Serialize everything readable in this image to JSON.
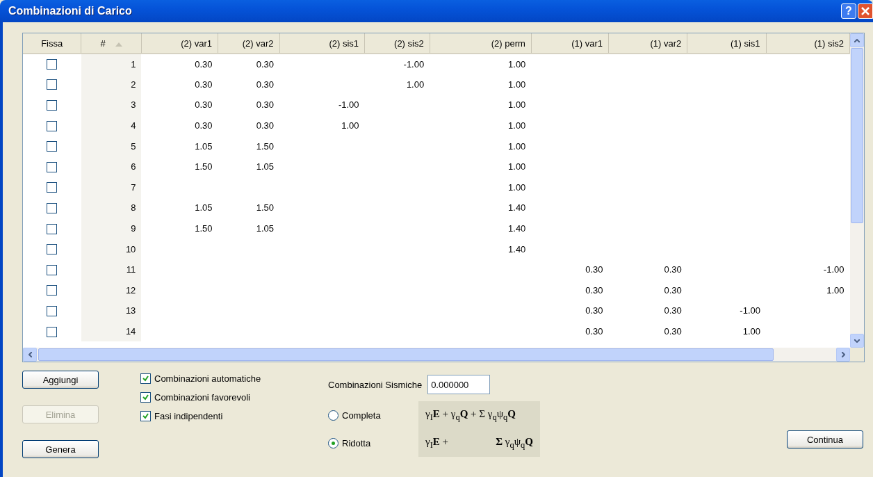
{
  "window": {
    "title": "Combinazioni di Carico",
    "buttons": [
      "?"
    ]
  },
  "table": {
    "columns": [
      {
        "label": "Fissa",
        "sorted": false
      },
      {
        "label": "#",
        "sorted": true
      },
      {
        "label": "(2) var1",
        "sorted": false
      },
      {
        "label": "(2) var2",
        "sorted": false
      },
      {
        "label": "(2) sis1",
        "sorted": false
      },
      {
        "label": "(2) sis2",
        "sorted": false
      },
      {
        "label": "(2) perm",
        "sorted": false
      },
      {
        "label": "(1) var1",
        "sorted": false
      },
      {
        "label": "(1) var2",
        "sorted": false
      },
      {
        "label": "(1) sis1",
        "sorted": false
      },
      {
        "label": "(1) sis2",
        "sorted": false
      }
    ],
    "rows": [
      {
        "cells": [
          {
            "kind": "check",
            "checked": false
          },
          {
            "kind": "number",
            "value": "1"
          },
          {
            "kind": "value",
            "value": "0.30"
          },
          {
            "kind": "value",
            "value": "0.30"
          },
          {
            "kind": "blank"
          },
          {
            "kind": "value",
            "value": "-1.00"
          },
          {
            "kind": "value",
            "value": "1.00"
          },
          {
            "kind": "blank"
          },
          {
            "kind": "blank"
          },
          {
            "kind": "blank"
          },
          {
            "kind": "blank"
          }
        ]
      },
      {
        "cells": [
          {
            "kind": "check",
            "checked": false
          },
          {
            "kind": "number",
            "value": "2"
          },
          {
            "kind": "value",
            "value": "0.30"
          },
          {
            "kind": "value",
            "value": "0.30"
          },
          {
            "kind": "blank"
          },
          {
            "kind": "value",
            "value": "1.00"
          },
          {
            "kind": "value",
            "value": "1.00"
          },
          {
            "kind": "blank"
          },
          {
            "kind": "blank"
          },
          {
            "kind": "blank"
          },
          {
            "kind": "blank"
          }
        ]
      },
      {
        "cells": [
          {
            "kind": "check",
            "checked": false
          },
          {
            "kind": "number",
            "value": "3"
          },
          {
            "kind": "value",
            "value": "0.30"
          },
          {
            "kind": "value",
            "value": "0.30"
          },
          {
            "kind": "value",
            "value": "-1.00"
          },
          {
            "kind": "blank"
          },
          {
            "kind": "value",
            "value": "1.00"
          },
          {
            "kind": "blank"
          },
          {
            "kind": "blank"
          },
          {
            "kind": "blank"
          },
          {
            "kind": "blank"
          }
        ]
      },
      {
        "cells": [
          {
            "kind": "check",
            "checked": false
          },
          {
            "kind": "number",
            "value": "4"
          },
          {
            "kind": "value",
            "value": "0.30"
          },
          {
            "kind": "value",
            "value": "0.30"
          },
          {
            "kind": "value",
            "value": "1.00"
          },
          {
            "kind": "blank"
          },
          {
            "kind": "value",
            "value": "1.00"
          },
          {
            "kind": "blank"
          },
          {
            "kind": "blank"
          },
          {
            "kind": "blank"
          },
          {
            "kind": "blank"
          }
        ]
      },
      {
        "cells": [
          {
            "kind": "check",
            "checked": false
          },
          {
            "kind": "number",
            "value": "5"
          },
          {
            "kind": "value",
            "value": "1.05"
          },
          {
            "kind": "value",
            "value": "1.50"
          },
          {
            "kind": "blank"
          },
          {
            "kind": "blank"
          },
          {
            "kind": "value",
            "value": "1.00"
          },
          {
            "kind": "blank"
          },
          {
            "kind": "blank"
          },
          {
            "kind": "blank"
          },
          {
            "kind": "blank"
          }
        ]
      },
      {
        "cells": [
          {
            "kind": "check",
            "checked": false
          },
          {
            "kind": "number",
            "value": "6"
          },
          {
            "kind": "value",
            "value": "1.50"
          },
          {
            "kind": "value",
            "value": "1.05"
          },
          {
            "kind": "blank"
          },
          {
            "kind": "blank"
          },
          {
            "kind": "value",
            "value": "1.00"
          },
          {
            "kind": "blank"
          },
          {
            "kind": "blank"
          },
          {
            "kind": "blank"
          },
          {
            "kind": "blank"
          }
        ]
      },
      {
        "cells": [
          {
            "kind": "check",
            "checked": false
          },
          {
            "kind": "number",
            "value": "7"
          },
          {
            "kind": "blank"
          },
          {
            "kind": "blank"
          },
          {
            "kind": "blank"
          },
          {
            "kind": "blank"
          },
          {
            "kind": "value",
            "value": "1.00"
          },
          {
            "kind": "blank"
          },
          {
            "kind": "blank"
          },
          {
            "kind": "blank"
          },
          {
            "kind": "blank"
          }
        ]
      },
      {
        "cells": [
          {
            "kind": "check",
            "checked": false
          },
          {
            "kind": "number",
            "value": "8"
          },
          {
            "kind": "value",
            "value": "1.05"
          },
          {
            "kind": "value",
            "value": "1.50"
          },
          {
            "kind": "blank"
          },
          {
            "kind": "blank"
          },
          {
            "kind": "value",
            "value": "1.40"
          },
          {
            "kind": "blank"
          },
          {
            "kind": "blank"
          },
          {
            "kind": "blank"
          },
          {
            "kind": "blank"
          }
        ]
      },
      {
        "cells": [
          {
            "kind": "check",
            "checked": false
          },
          {
            "kind": "number",
            "value": "9"
          },
          {
            "kind": "value",
            "value": "1.50"
          },
          {
            "kind": "value",
            "value": "1.05"
          },
          {
            "kind": "blank"
          },
          {
            "kind": "blank"
          },
          {
            "kind": "value",
            "value": "1.40"
          },
          {
            "kind": "blank"
          },
          {
            "kind": "blank"
          },
          {
            "kind": "blank"
          },
          {
            "kind": "blank"
          }
        ]
      },
      {
        "cells": [
          {
            "kind": "check",
            "checked": false
          },
          {
            "kind": "number",
            "value": "10"
          },
          {
            "kind": "blank"
          },
          {
            "kind": "blank"
          },
          {
            "kind": "blank"
          },
          {
            "kind": "blank"
          },
          {
            "kind": "value",
            "value": "1.40"
          },
          {
            "kind": "blank"
          },
          {
            "kind": "blank"
          },
          {
            "kind": "blank"
          },
          {
            "kind": "blank"
          }
        ]
      },
      {
        "cells": [
          {
            "kind": "check",
            "checked": false
          },
          {
            "kind": "number",
            "value": "11"
          },
          {
            "kind": "blank"
          },
          {
            "kind": "blank"
          },
          {
            "kind": "blank"
          },
          {
            "kind": "blank"
          },
          {
            "kind": "blank"
          },
          {
            "kind": "value",
            "value": "0.30"
          },
          {
            "kind": "value",
            "value": "0.30"
          },
          {
            "kind": "blank"
          },
          {
            "kind": "value",
            "value": "-1.00"
          }
        ]
      },
      {
        "cells": [
          {
            "kind": "check",
            "checked": false
          },
          {
            "kind": "number",
            "value": "12"
          },
          {
            "kind": "blank"
          },
          {
            "kind": "blank"
          },
          {
            "kind": "blank"
          },
          {
            "kind": "blank"
          },
          {
            "kind": "blank"
          },
          {
            "kind": "value",
            "value": "0.30"
          },
          {
            "kind": "value",
            "value": "0.30"
          },
          {
            "kind": "blank"
          },
          {
            "kind": "value",
            "value": "1.00"
          }
        ]
      },
      {
        "cells": [
          {
            "kind": "check",
            "checked": false
          },
          {
            "kind": "number",
            "value": "13"
          },
          {
            "kind": "blank"
          },
          {
            "kind": "blank"
          },
          {
            "kind": "blank"
          },
          {
            "kind": "blank"
          },
          {
            "kind": "blank"
          },
          {
            "kind": "value",
            "value": "0.30"
          },
          {
            "kind": "value",
            "value": "0.30"
          },
          {
            "kind": "value",
            "value": "-1.00"
          },
          {
            "kind": "blank"
          }
        ]
      },
      {
        "cells": [
          {
            "kind": "check",
            "checked": false
          },
          {
            "kind": "number",
            "value": "14"
          },
          {
            "kind": "blank"
          },
          {
            "kind": "blank"
          },
          {
            "kind": "blank"
          },
          {
            "kind": "blank"
          },
          {
            "kind": "blank"
          },
          {
            "kind": "value",
            "value": "0.30"
          },
          {
            "kind": "value",
            "value": "0.30"
          },
          {
            "kind": "value",
            "value": "1.00"
          },
          {
            "kind": "blank"
          }
        ]
      }
    ]
  },
  "buttons": [
    {
      "label": "Aggiungi",
      "disabled": false
    },
    {
      "label": "Elimina",
      "disabled": true
    },
    {
      "label": "Genera",
      "disabled": false
    }
  ],
  "options": [
    {
      "label": "Combinazioni automatiche",
      "checked": true
    },
    {
      "label": "Combinazioni favorevoli",
      "checked": true
    },
    {
      "label": "Fasi indipendenti",
      "checked": true
    }
  ],
  "seismic": {
    "label": "Combinazioni Sismiche",
    "value": "0.000000"
  },
  "modes": [
    {
      "label": "Completa",
      "selected": false,
      "formula": [
        "γ$_{I}$**E** + γ$_{q}$**Q** + Σ γ$_{q}$ψ$_{q}$**Q**"
      ]
    },
    {
      "label": "Ridotta",
      "selected": true,
      "formula": [
        "γ$_{I}$**E** +",
        "**Σ** γ$_{q}$ψ$_{q}$**Q**"
      ]
    }
  ],
  "continue_button": "Continua"
}
